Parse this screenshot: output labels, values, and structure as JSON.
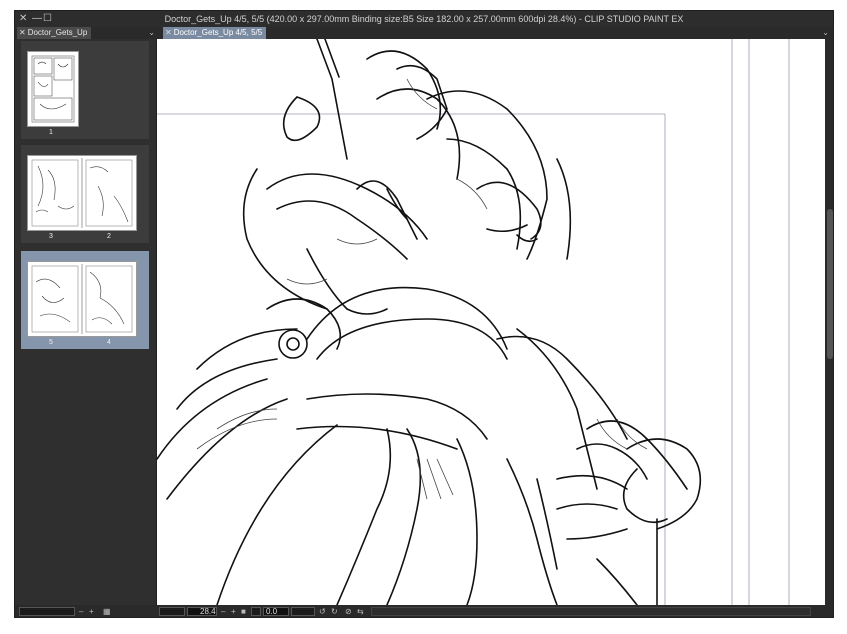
{
  "window": {
    "title": "Doctor_Gets_Up 4/5, 5/5 (420.00 x 297.00mm Binding size:B5 Size 182.00 x 257.00mm 600dpi 28.4%)  - CLIP STUDIO PAINT EX",
    "close_glyph": "✕",
    "minimize_glyph": "—",
    "maximize_glyph": "☐"
  },
  "tabs": {
    "left_tab": "Doctor_Gets_Up",
    "canvas_tab": "Doctor_Gets_Up 4/5, 5/5",
    "close_glyph": "✕",
    "chevron_glyph": "⌄"
  },
  "page_manager": {
    "pages": [
      {
        "labels": [
          "1"
        ],
        "selected": false
      },
      {
        "labels": [
          "3",
          "2"
        ],
        "selected": false
      },
      {
        "labels": [
          "5",
          "4"
        ],
        "selected": true
      }
    ]
  },
  "status_bar": {
    "zoom": "28.4",
    "rotation": "0.0",
    "minus": "–",
    "plus": "+"
  },
  "colors": {
    "window_bg": "#3a3a3a",
    "titlebar": "#2d2d2d",
    "selected_page": "#8595ab",
    "active_tab": "#7a8aa0",
    "canvas": "#ffffff"
  }
}
